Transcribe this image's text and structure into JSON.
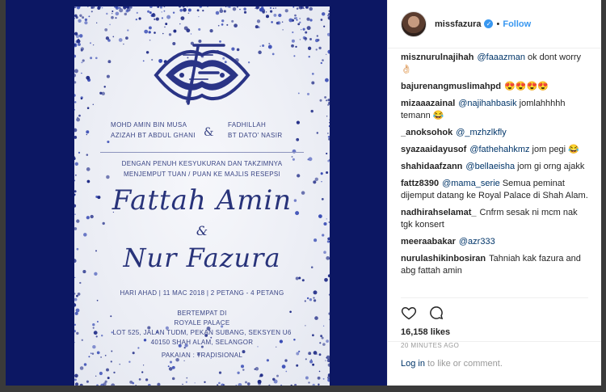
{
  "post": {
    "username": "missfazura",
    "verified": true,
    "follow_label": "Follow",
    "separator": "•",
    "likes": "16,158 likes",
    "time": "20 MINUTES AGO",
    "login_link": "Log in",
    "login_suffix": "to like or comment."
  },
  "invitation": {
    "parent_left_1": "MOHD AMIN BIN MUSA",
    "parent_left_2": "AZIZAH BT ABDUL GHANI",
    "amp": "&",
    "parent_right_1": "FADHILLAH",
    "parent_right_2": "BT DATO' NASIR",
    "intro_1": "DENGAN PENUH KESYUKURAN DAN TAKZIMNYA",
    "intro_2": "MENJEMPUT TUAN / PUAN KE MAJLIS RESEPSI",
    "name_1": "Fattah Amin",
    "name_amp": "&",
    "name_2": "Nur Fazura",
    "date": "HARI AHAD | 11 MAC 2018 | 2 PETANG - 4 PETANG",
    "venue_1": "BERTEMPAT DI",
    "venue_2": "ROYALE PALACE",
    "venue_3": "LOT 525, JALAN TUDM, PEKAN SUBANG, SEKSYEN U6",
    "venue_4": "40150 SHAH ALAM, SELANGOR",
    "attire": "PAKAIAN : TRADISIONAL"
  },
  "comments": [
    {
      "user": "misznurulnajihah",
      "mention": "@faaazman",
      "text": " ok dont worry 👌🏻"
    },
    {
      "user": "bajurenangmuslimahpd",
      "mention": "",
      "text": "😍😍😍😍"
    },
    {
      "user": "mizaaazainal",
      "mention": "@najihahbasik",
      "text": " jomlahhhhh temann 😂"
    },
    {
      "user": "_anoksohok",
      "mention": "@_mzhzlkfly",
      "text": ""
    },
    {
      "user": "syazaaidayusof",
      "mention": "@fathehahkmz",
      "text": " jom pegi 😂"
    },
    {
      "user": "shahidaafzann",
      "mention": "@bellaeisha",
      "text": " jom gi orng ajakk"
    },
    {
      "user": "fattz8390",
      "mention": "@mama_serie",
      "text": " Semua peminat dijemput datang ke Royal Palace di Shah Alam."
    },
    {
      "user": "nadhirahselamat_",
      "mention": "",
      "text": "Cnfrm sesak ni mcm nak tgk konsert"
    },
    {
      "user": "meeraabakar",
      "mention": "@azr333",
      "text": ""
    },
    {
      "user": "nurulashikinbosiran",
      "mention": "",
      "text": "Tahniah kak fazura and abg fattah amin"
    }
  ],
  "colors": {
    "navy": "#0c1763",
    "ink": "#28337a",
    "link": "#3897f0"
  },
  "icons": [
    "heart-icon",
    "comment-icon",
    "verified-icon"
  ]
}
